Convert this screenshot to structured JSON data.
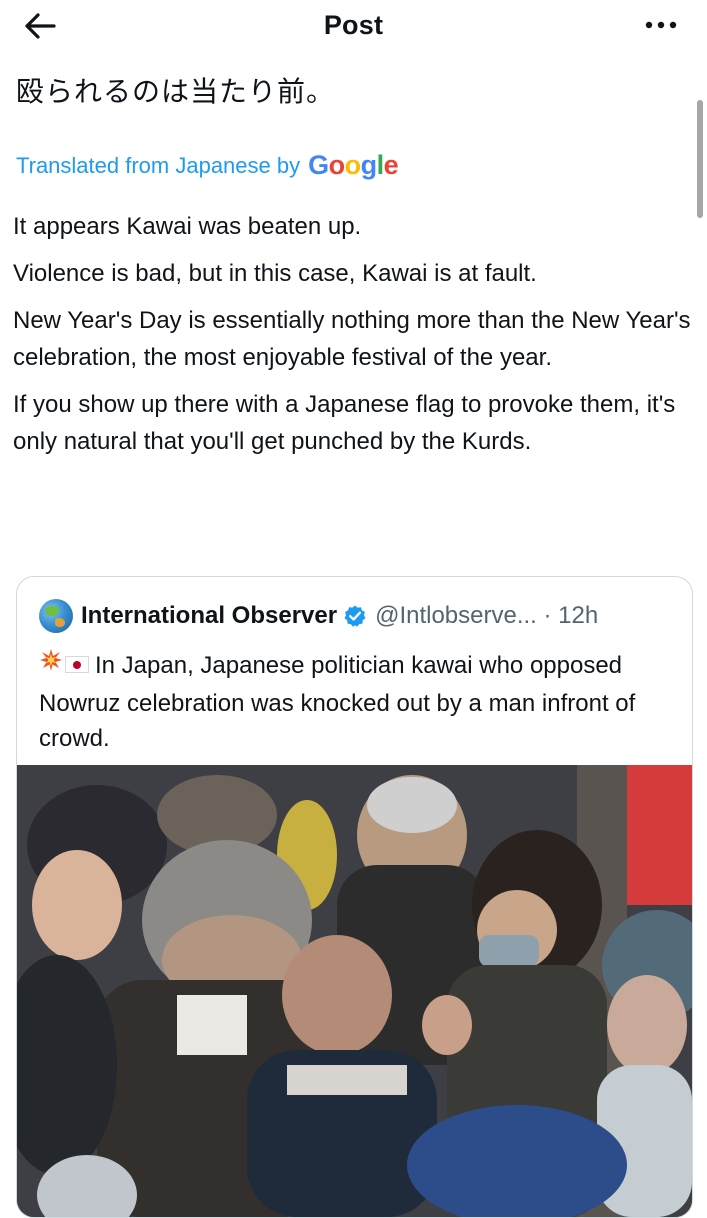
{
  "header": {
    "title": "Post",
    "back_icon": "arrow-left-icon",
    "more_icon": "more-horizontal-icon"
  },
  "post": {
    "original_text": "殴られるのは当たり前。",
    "translated_label": "Translated from Japanese by",
    "translator_logo_text": "Google",
    "translation_paragraphs": [
      "It appears Kawai was beaten up.",
      "Violence is bad, but in this case, Kawai is at fault.",
      "New Year's Day is essentially nothing more than the New Year's celebration, the most enjoyable festival of the year.",
      "If you show up there with a Japanese flag to provoke them, it's only natural that you'll get punched by the Kurds."
    ]
  },
  "quote": {
    "author_name": "International Observer",
    "verified_icon": "verified-badge-icon",
    "handle_time": "@Intlobserve... · 12h",
    "text": "In Japan, Japanese politician kawai who opposed Nowruz celebration was knocked out by a man infront of crowd.",
    "emojis": [
      "collision-icon",
      "japan-flag-icon"
    ],
    "media_alt": "crowd-photo"
  },
  "colors": {
    "link_blue": "#1d9bf0",
    "text_primary": "#0f1419",
    "text_secondary": "#536471",
    "border": "#cfd9de"
  }
}
